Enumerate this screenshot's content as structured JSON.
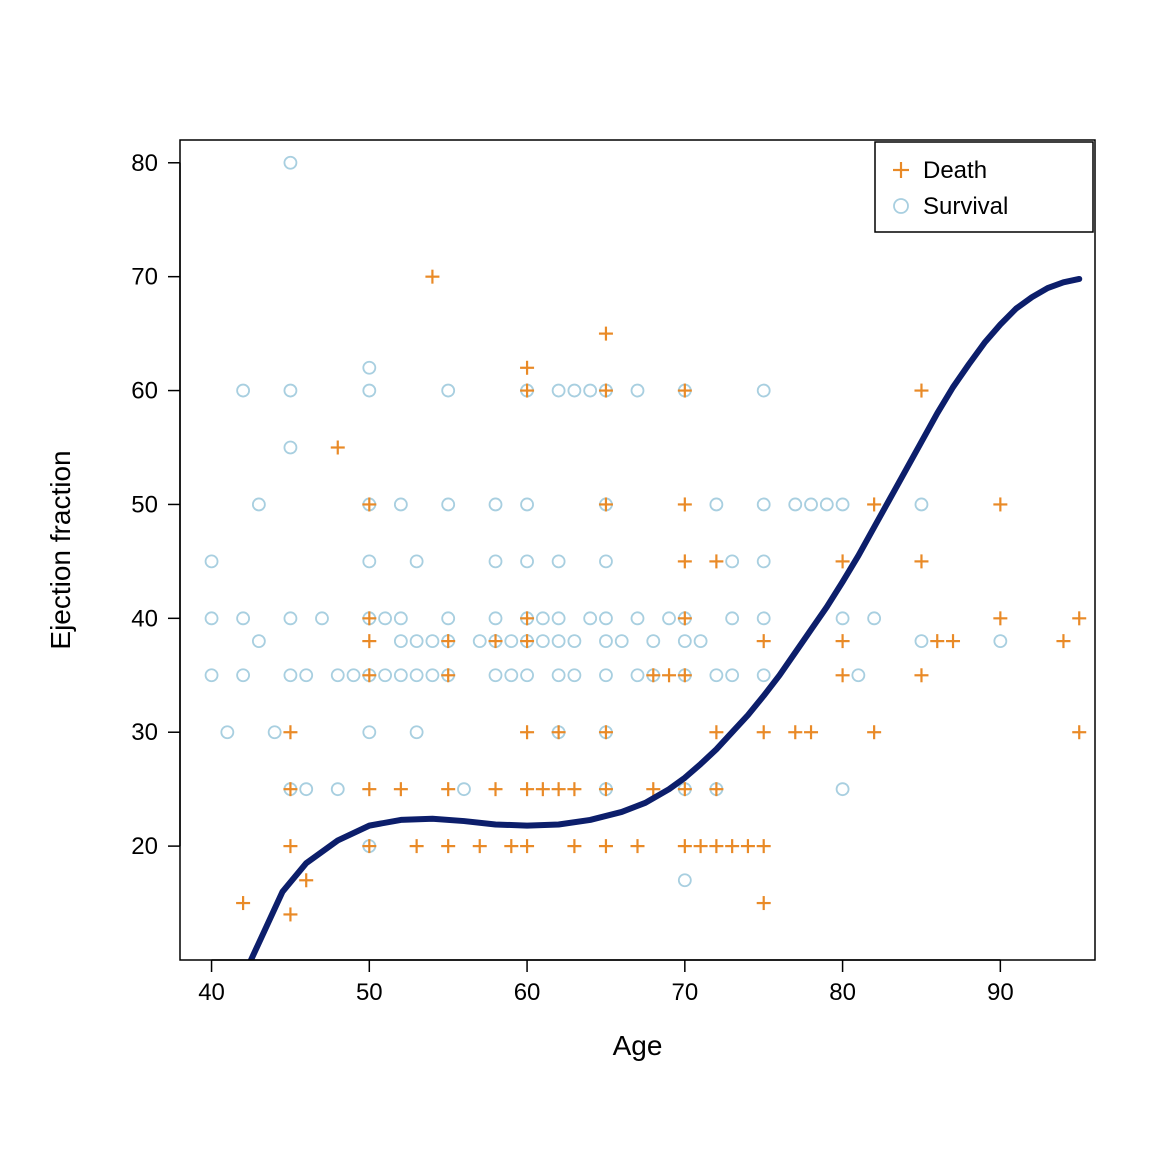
{
  "chart_data": {
    "type": "scatter",
    "xlabel": "Age",
    "ylabel": "Ejection fraction",
    "xlim": [
      38,
      96
    ],
    "ylim": [
      10,
      82
    ],
    "x_ticks": [
      40,
      50,
      60,
      70,
      80,
      90
    ],
    "y_ticks": [
      20,
      30,
      40,
      50,
      60,
      70,
      80
    ],
    "legend": {
      "position": "topright",
      "entries": [
        {
          "name": "Death",
          "marker": "plus",
          "color": "#e98a27"
        },
        {
          "name": "Survival",
          "marker": "circle",
          "color": "#a8cfe0"
        }
      ]
    },
    "curve": {
      "color": "#0c1e6b",
      "points": [
        [
          42.5,
          10
        ],
        [
          43.5,
          13
        ],
        [
          44.5,
          16
        ],
        [
          46,
          18.5
        ],
        [
          48,
          20.5
        ],
        [
          50,
          21.8
        ],
        [
          52,
          22.3
        ],
        [
          54,
          22.4
        ],
        [
          56,
          22.2
        ],
        [
          58,
          21.9
        ],
        [
          60,
          21.8
        ],
        [
          62,
          21.9
        ],
        [
          64,
          22.3
        ],
        [
          66,
          23
        ],
        [
          67.5,
          23.8
        ],
        [
          69,
          25
        ],
        [
          70,
          26
        ],
        [
          71,
          27.2
        ],
        [
          72,
          28.5
        ],
        [
          73,
          30
        ],
        [
          74,
          31.5
        ],
        [
          75,
          33.2
        ],
        [
          76,
          35
        ],
        [
          77,
          37
        ],
        [
          78,
          39
        ],
        [
          79,
          41
        ],
        [
          80,
          43.2
        ],
        [
          81,
          45.5
        ],
        [
          82,
          48
        ],
        [
          83,
          50.5
        ],
        [
          84,
          53
        ],
        [
          85,
          55.5
        ],
        [
          86,
          58
        ],
        [
          87,
          60.3
        ],
        [
          88,
          62.3
        ],
        [
          89,
          64.2
        ],
        [
          90,
          65.8
        ],
        [
          91,
          67.2
        ],
        [
          92,
          68.2
        ],
        [
          93,
          69
        ],
        [
          94,
          69.5
        ],
        [
          95,
          69.8
        ]
      ]
    },
    "series": [
      {
        "name": "Death",
        "marker": "plus",
        "color": "#e98a27",
        "points": [
          [
            42,
            15
          ],
          [
            45,
            20
          ],
          [
            45,
            30
          ],
          [
            45,
            25
          ],
          [
            45,
            14
          ],
          [
            46,
            17
          ],
          [
            48,
            55
          ],
          [
            50,
            20
          ],
          [
            50,
            25
          ],
          [
            50,
            35
          ],
          [
            50,
            40
          ],
          [
            50,
            50
          ],
          [
            50,
            38
          ],
          [
            52,
            25
          ],
          [
            53,
            20
          ],
          [
            54,
            70
          ],
          [
            55,
            20
          ],
          [
            55,
            25
          ],
          [
            55,
            35
          ],
          [
            55,
            38
          ],
          [
            57,
            20
          ],
          [
            58,
            25
          ],
          [
            58,
            38
          ],
          [
            59,
            20
          ],
          [
            60,
            20
          ],
          [
            60,
            25
          ],
          [
            60,
            30
          ],
          [
            60,
            38
          ],
          [
            60,
            40
          ],
          [
            60,
            60
          ],
          [
            60,
            62
          ],
          [
            61,
            25
          ],
          [
            62,
            25
          ],
          [
            62,
            30
          ],
          [
            63,
            25
          ],
          [
            63,
            20
          ],
          [
            65,
            20
          ],
          [
            65,
            25
          ],
          [
            65,
            30
          ],
          [
            65,
            50
          ],
          [
            65,
            65
          ],
          [
            65,
            60
          ],
          [
            67,
            20
          ],
          [
            68,
            25
          ],
          [
            68,
            35
          ],
          [
            69,
            35
          ],
          [
            70,
            20
          ],
          [
            70,
            25
          ],
          [
            70,
            35
          ],
          [
            70,
            40
          ],
          [
            70,
            45
          ],
          [
            70,
            50
          ],
          [
            70,
            60
          ],
          [
            71,
            20
          ],
          [
            72,
            20
          ],
          [
            72,
            25
          ],
          [
            72,
            30
          ],
          [
            72,
            45
          ],
          [
            73,
            20
          ],
          [
            74,
            20
          ],
          [
            75,
            15
          ],
          [
            75,
            20
          ],
          [
            75,
            30
          ],
          [
            75,
            38
          ],
          [
            77,
            30
          ],
          [
            78,
            30
          ],
          [
            80,
            35
          ],
          [
            80,
            38
          ],
          [
            80,
            45
          ],
          [
            82,
            30
          ],
          [
            82,
            50
          ],
          [
            85,
            35
          ],
          [
            85,
            45
          ],
          [
            85,
            60
          ],
          [
            86,
            38
          ],
          [
            87,
            38
          ],
          [
            90,
            40
          ],
          [
            90,
            50
          ],
          [
            94,
            38
          ],
          [
            95,
            30
          ],
          [
            95,
            40
          ]
        ]
      },
      {
        "name": "Survival",
        "marker": "circle",
        "color": "#a8cfe0",
        "points": [
          [
            40,
            35
          ],
          [
            40,
            40
          ],
          [
            40,
            45
          ],
          [
            41,
            30
          ],
          [
            42,
            35
          ],
          [
            42,
            40
          ],
          [
            42,
            60
          ],
          [
            43,
            38
          ],
          [
            43,
            50
          ],
          [
            44,
            30
          ],
          [
            45,
            35
          ],
          [
            45,
            40
          ],
          [
            45,
            25
          ],
          [
            45,
            55
          ],
          [
            45,
            60
          ],
          [
            45,
            80
          ],
          [
            46,
            35
          ],
          [
            46,
            25
          ],
          [
            47,
            40
          ],
          [
            48,
            25
          ],
          [
            48,
            35
          ],
          [
            49,
            35
          ],
          [
            50,
            30
          ],
          [
            50,
            35
          ],
          [
            50,
            40
          ],
          [
            50,
            45
          ],
          [
            50,
            50
          ],
          [
            50,
            60
          ],
          [
            50,
            62
          ],
          [
            50,
            20
          ],
          [
            51,
            35
          ],
          [
            51,
            40
          ],
          [
            52,
            35
          ],
          [
            52,
            38
          ],
          [
            52,
            40
          ],
          [
            52,
            50
          ],
          [
            53,
            30
          ],
          [
            53,
            35
          ],
          [
            53,
            38
          ],
          [
            53,
            45
          ],
          [
            54,
            35
          ],
          [
            54,
            38
          ],
          [
            55,
            35
          ],
          [
            55,
            38
          ],
          [
            55,
            40
          ],
          [
            55,
            50
          ],
          [
            55,
            60
          ],
          [
            56,
            25
          ],
          [
            57,
            38
          ],
          [
            58,
            35
          ],
          [
            58,
            38
          ],
          [
            58,
            40
          ],
          [
            58,
            45
          ],
          [
            58,
            50
          ],
          [
            59,
            35
          ],
          [
            59,
            38
          ],
          [
            60,
            35
          ],
          [
            60,
            38
          ],
          [
            60,
            40
          ],
          [
            60,
            45
          ],
          [
            60,
            50
          ],
          [
            60,
            60
          ],
          [
            61,
            38
          ],
          [
            61,
            40
          ],
          [
            62,
            30
          ],
          [
            62,
            35
          ],
          [
            62,
            38
          ],
          [
            62,
            40
          ],
          [
            62,
            45
          ],
          [
            62,
            60
          ],
          [
            63,
            35
          ],
          [
            63,
            38
          ],
          [
            63,
            60
          ],
          [
            64,
            40
          ],
          [
            64,
            60
          ],
          [
            65,
            25
          ],
          [
            65,
            30
          ],
          [
            65,
            35
          ],
          [
            65,
            38
          ],
          [
            65,
            40
          ],
          [
            65,
            45
          ],
          [
            65,
            50
          ],
          [
            65,
            60
          ],
          [
            66,
            38
          ],
          [
            67,
            35
          ],
          [
            67,
            40
          ],
          [
            67,
            60
          ],
          [
            68,
            35
          ],
          [
            68,
            38
          ],
          [
            69,
            40
          ],
          [
            70,
            17
          ],
          [
            70,
            25
          ],
          [
            70,
            35
          ],
          [
            70,
            38
          ],
          [
            70,
            40
          ],
          [
            70,
            60
          ],
          [
            71,
            38
          ],
          [
            72,
            25
          ],
          [
            72,
            35
          ],
          [
            72,
            50
          ],
          [
            73,
            35
          ],
          [
            73,
            40
          ],
          [
            73,
            45
          ],
          [
            75,
            35
          ],
          [
            75,
            40
          ],
          [
            75,
            45
          ],
          [
            75,
            50
          ],
          [
            75,
            60
          ],
          [
            77,
            50
          ],
          [
            78,
            50
          ],
          [
            79,
            50
          ],
          [
            80,
            25
          ],
          [
            80,
            50
          ],
          [
            80,
            40
          ],
          [
            81,
            35
          ],
          [
            82,
            40
          ],
          [
            85,
            38
          ],
          [
            85,
            50
          ],
          [
            90,
            38
          ]
        ]
      }
    ]
  }
}
